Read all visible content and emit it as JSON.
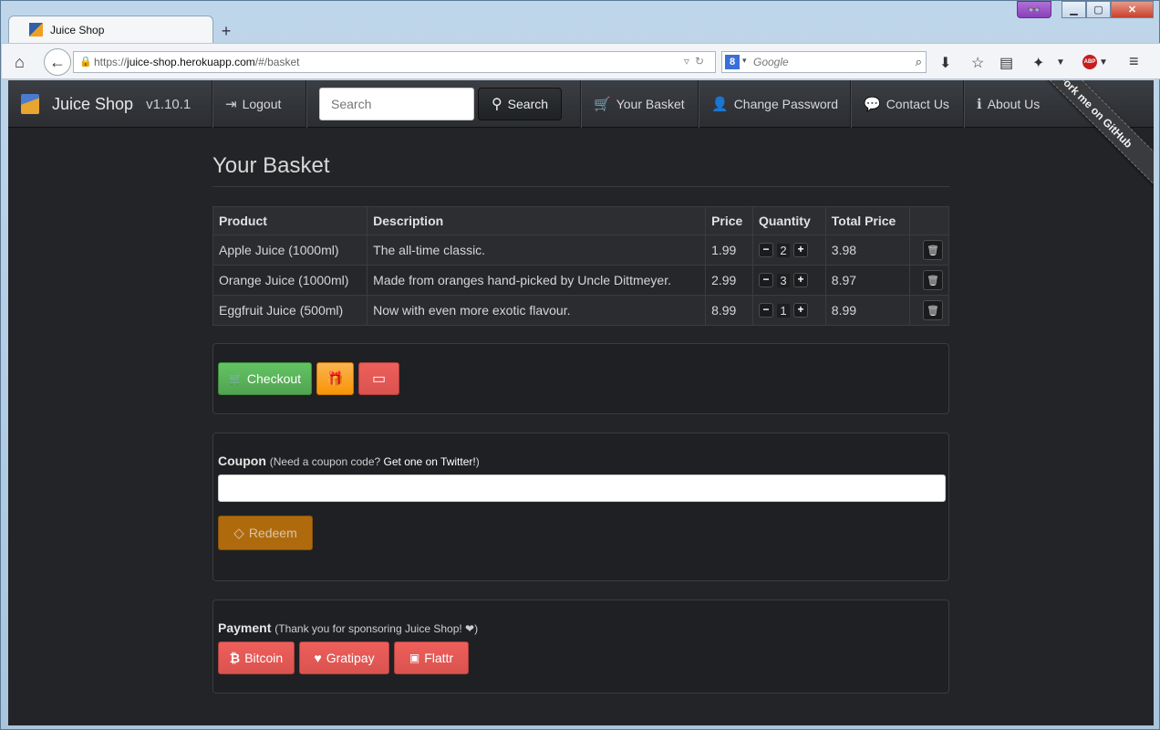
{
  "browser": {
    "tab_title": "Juice Shop",
    "new_tab_glyph": "+",
    "url_prefix": "https://",
    "url_host": "juice-shop.herokuapp.com",
    "url_path": "/#/basket",
    "search_engine_placeholder": "Google"
  },
  "app": {
    "brand_name": "Juice Shop",
    "version": "v1.10.1",
    "nav": {
      "logout": "Logout",
      "search_placeholder": "Search",
      "search_button": "Search",
      "your_basket": "Your Basket",
      "change_password": "Change Password",
      "contact_us": "Contact Us",
      "about_us": "About Us"
    },
    "ribbon": "Fork me on GitHub"
  },
  "basket": {
    "title": "Your Basket",
    "columns": [
      "Product",
      "Description",
      "Price",
      "Quantity",
      "Total Price",
      ""
    ],
    "rows": [
      {
        "product": "Apple Juice (1000ml)",
        "description": "The all-time classic.",
        "price": "1.99",
        "quantity": "2",
        "total": "3.98"
      },
      {
        "product": "Orange Juice (1000ml)",
        "description": "Made from oranges hand-picked by Uncle Dittmeyer.",
        "price": "2.99",
        "quantity": "3",
        "total": "8.97"
      },
      {
        "product": "Eggfruit Juice (500ml)",
        "description": "Now with even more exotic flavour.",
        "price": "8.99",
        "quantity": "1",
        "total": "8.99"
      }
    ]
  },
  "checkout": {
    "checkout_label": "Checkout"
  },
  "coupon": {
    "label": "Coupon",
    "hint_prefix": "(Need a coupon code? ",
    "hint_link": "Get one on Twitter!",
    "hint_suffix": ")",
    "input_value": "",
    "redeem_label": "Redeem"
  },
  "payment": {
    "label": "Payment",
    "hint": "(Thank you for sponsoring Juice Shop! ❤)",
    "bitcoin": "Bitcoin",
    "gratipay": "Gratipay",
    "flattr": "Flattr"
  },
  "colors": {
    "page_bg": "#232427",
    "success": "#5cb85c",
    "warning": "#f89406",
    "danger": "#d9534f"
  }
}
